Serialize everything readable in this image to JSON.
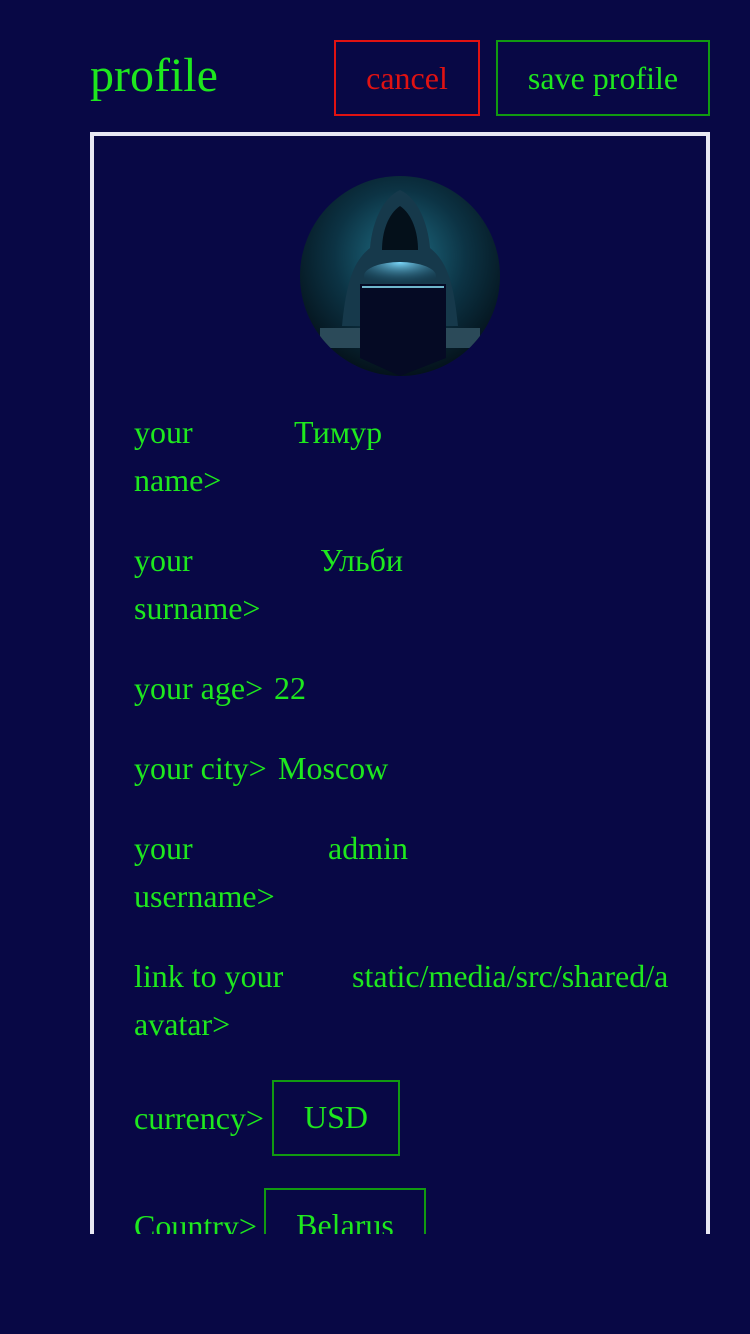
{
  "header": {
    "title": "profile",
    "cancel_label": "cancel",
    "save_label": "save profile"
  },
  "avatar": {
    "icon": "hooded-hacker-avatar"
  },
  "fields": {
    "name": {
      "label_1": "your",
      "label_2": "name>",
      "value": "Тимур"
    },
    "surname": {
      "label_1": "your",
      "label_2": "surname>",
      "value": "Ульби"
    },
    "age": {
      "label": "your age>",
      "value": "22"
    },
    "city": {
      "label": "your city>",
      "value": "Moscow"
    },
    "username": {
      "label_1": "your",
      "label_2": "username>",
      "value": "admin"
    },
    "avatar_link": {
      "label_1": "link to your",
      "label_2": "avatar>",
      "value": "static/media/src/shared/a"
    },
    "currency": {
      "label": "currency>",
      "value": "USD"
    },
    "country": {
      "label": "Country>",
      "value": "Belarus"
    }
  },
  "colors": {
    "background": "#080845",
    "text": "#1ee81e",
    "cancel": "#e01212",
    "border_green": "#119a11",
    "card_border": "#e8e8f4"
  }
}
